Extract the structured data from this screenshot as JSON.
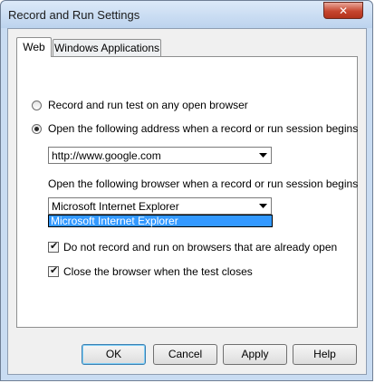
{
  "window": {
    "title": "Record and Run Settings",
    "close_symbol": "✕"
  },
  "tabs": [
    {
      "label": "Web",
      "selected": true
    },
    {
      "label": "Windows Applications",
      "selected": false
    }
  ],
  "options": {
    "any_browser": {
      "label": "Record and run test on any open browser",
      "selected": false
    },
    "open_address": {
      "label": "Open the following address when a record or run session begins",
      "selected": true
    },
    "address_value": "http://www.google.com",
    "browser_label": "Open the following browser when a record or run session begins",
    "browser_value": "Microsoft Internet Explorer",
    "browser_list": [
      "Microsoft Internet Explorer"
    ],
    "no_record_open": {
      "label": "Do not record and run on browsers that are already open",
      "checked": true
    },
    "close_browser": {
      "label": "Close the browser when the test closes",
      "checked": true
    },
    "check_symbol": "✔"
  },
  "buttons": {
    "ok": "OK",
    "cancel": "Cancel",
    "apply": "Apply",
    "help": "Help"
  },
  "colors": {
    "selection": "#3399ff",
    "close_button": "#c6462f",
    "window_frame": "#c9dcf2"
  }
}
